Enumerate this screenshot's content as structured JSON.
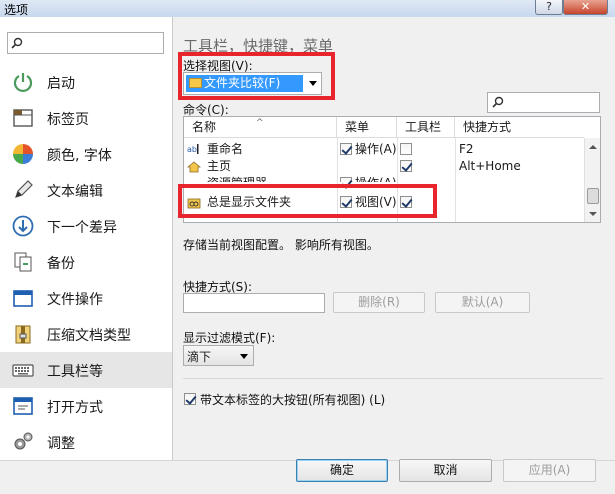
{
  "window": {
    "title": "选项",
    "help_label": "?",
    "close_label": "✕"
  },
  "nav": {
    "search_placeholder": "",
    "items": [
      {
        "label": "启动",
        "icon": "power-icon"
      },
      {
        "label": "标签页",
        "icon": "tab-page-icon"
      },
      {
        "label": "颜色, 字体",
        "icon": "palette-icon"
      },
      {
        "label": "文本编辑",
        "icon": "pencil-icon"
      },
      {
        "label": "下一个差异",
        "icon": "next-diff-icon"
      },
      {
        "label": "备份",
        "icon": "backup-icon"
      },
      {
        "label": "文件操作",
        "icon": "file-ops-icon"
      },
      {
        "label": "压缩文档类型",
        "icon": "archive-icon"
      },
      {
        "label": "工具栏等",
        "icon": "keyboard-icon"
      },
      {
        "label": "打开方式",
        "icon": "open-with-icon"
      },
      {
        "label": "调整",
        "icon": "gears-icon"
      }
    ],
    "selected_index": 8
  },
  "main": {
    "heading": "工具栏，快捷键，菜单",
    "select_view_label": "选择视图(V):",
    "select_view_value": "文件夹比较(F)",
    "commands_label": "命令(C):",
    "commands_search_placeholder": "",
    "columns": [
      "名称",
      "菜单",
      "工具栏",
      "快捷方式"
    ],
    "rows": [
      {
        "name": "重命名",
        "menu_checked": true,
        "menu": "操作(A)",
        "toolbar_checked": false,
        "shortcut": "F2"
      },
      {
        "name": "主页",
        "menu_checked": false,
        "menu": "",
        "toolbar_checked": true,
        "shortcut": "Alt+Home"
      },
      {
        "name": "资源管理器",
        "menu_checked": true,
        "menu": "操作(A)",
        "toolbar_checked": true,
        "shortcut": ""
      },
      {
        "name": "总是显示文件夹",
        "menu_checked": true,
        "menu": "视图(V)",
        "toolbar_checked": true,
        "shortcut": ""
      }
    ],
    "store_note": "存储当前视图配置。 影响所有视图。",
    "shortcut_label": "快捷方式(S):",
    "shortcut_value": "",
    "delete_label": "删除(R)",
    "default_label": "默认(A)",
    "filter_label": "显示过滤模式(F):",
    "filter_value": "滴下",
    "big_buttons_label": "带文本标签的大按钮(所有视图) (L)",
    "big_buttons_checked": true
  },
  "footer": {
    "ok_label": "确定",
    "cancel_label": "取消",
    "apply_label": "应用(A)"
  },
  "colors": {
    "accent": "#3399ff",
    "highlight_box": "#e8242c",
    "close_button": "#c6452c"
  }
}
